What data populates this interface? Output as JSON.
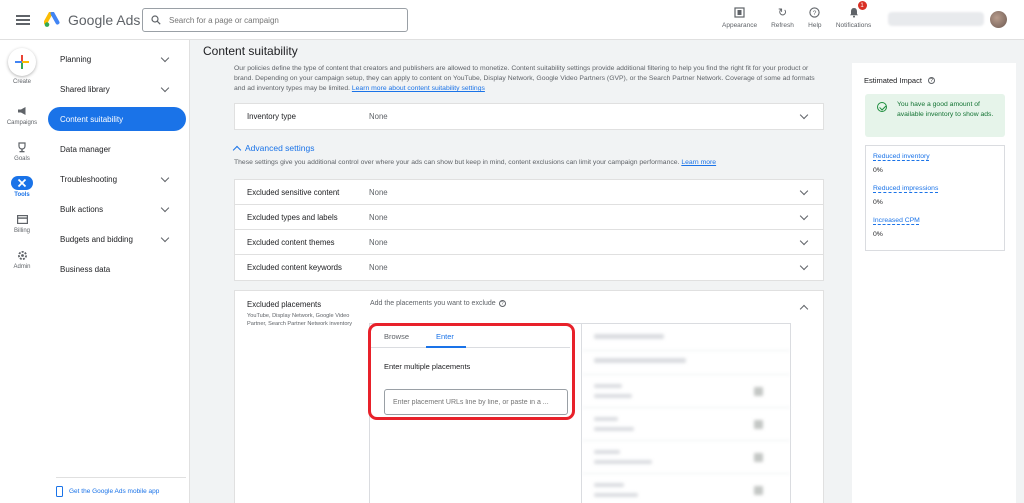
{
  "app": {
    "name": "Google Ads",
    "search_placeholder": "Search for a page or campaign"
  },
  "top_actions": [
    {
      "label": "Appearance",
      "icon": "appearance-icon"
    },
    {
      "label": "Refresh",
      "icon": "refresh-icon"
    },
    {
      "label": "Help",
      "icon": "help-icon"
    },
    {
      "label": "Notifications",
      "icon": "bell-icon",
      "badge": "1"
    }
  ],
  "rail": {
    "create": "Create",
    "items": [
      {
        "label": "Campaigns",
        "icon": "megaphone-icon"
      },
      {
        "label": "Goals",
        "icon": "trophy-icon"
      },
      {
        "label": "Tools",
        "icon": "tools-icon",
        "active": true
      },
      {
        "label": "Billing",
        "icon": "card-icon"
      },
      {
        "label": "Admin",
        "icon": "gear-icon"
      }
    ]
  },
  "nav": {
    "items": [
      {
        "label": "Planning",
        "expandable": true
      },
      {
        "label": "Shared library",
        "expandable": true
      },
      {
        "label": "Content suitability",
        "active": true
      },
      {
        "label": "Data manager"
      },
      {
        "label": "Troubleshooting",
        "expandable": true
      },
      {
        "label": "Bulk actions",
        "expandable": true
      },
      {
        "label": "Budgets and bidding",
        "expandable": true
      },
      {
        "label": "Business data"
      }
    ],
    "mobile_link": "Get the Google Ads mobile app"
  },
  "main": {
    "title": "Content suitability",
    "description": "Our policies define the type of content that creators and publishers are allowed to monetize. Content suitability settings provide additional filtering to help you find the right fit for your product or brand. Depending on your campaign setup, they can apply to content on YouTube, Display Network, Google Video Partners (GVP), or the Search Partner Network. Coverage of some ad formats and ad inventory types may be limited. ",
    "description_link": "Learn more about content suitability settings",
    "inventory": {
      "label": "Inventory type",
      "value": "None"
    },
    "advanced_toggle": "Advanced settings",
    "advanced_desc": "These settings give you additional control over where your ads can show but keep in mind, content exclusions can limit your campaign performance. ",
    "advanced_link": "Learn more",
    "exclusions": [
      {
        "label": "Excluded sensitive content",
        "value": "None"
      },
      {
        "label": "Excluded types and labels",
        "value": "None"
      },
      {
        "label": "Excluded content themes",
        "value": "None"
      },
      {
        "label": "Excluded content keywords",
        "value": "None"
      }
    ],
    "placements": {
      "title": "Excluded placements",
      "subtitle": "YouTube, Display Network, Google Video Partner, Search Partner Network inventory",
      "prompt": "Add the placements you want to exclude",
      "tabs": [
        "Browse",
        "Enter"
      ],
      "active_tab": "Enter",
      "multi_label": "Enter multiple placements",
      "input_placeholder": "Enter placement URLs line by line, or paste in a ..."
    }
  },
  "impact": {
    "title": "Estimated Impact",
    "banner": "You have a good amount of available inventory to show ads.",
    "metrics": [
      {
        "name": "Reduced inventory",
        "value": "0%"
      },
      {
        "name": "Reduced impressions",
        "value": "0%"
      },
      {
        "name": "Increased CPM",
        "value": "0%"
      }
    ]
  },
  "colors": {
    "accent": "#1a73e8",
    "highlight": "#e8212a",
    "success_bg": "#e6f4ea",
    "success_text": "#137333"
  }
}
